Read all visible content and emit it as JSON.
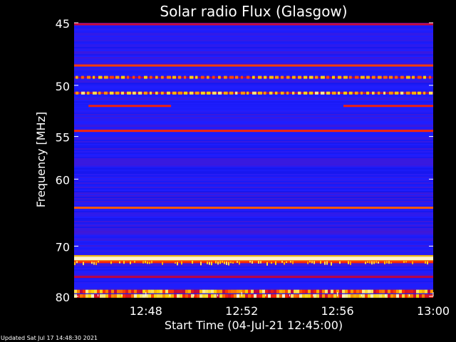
{
  "chart_data": {
    "type": "heatmap",
    "title": "Solar radio Flux (Glasgow)",
    "xlabel": "Start Time (04-Jul-21 12:45:00)",
    "ylabel": "Frequency [MHz]",
    "x_ticks": [
      "12:48",
      "12:52",
      "12:56",
      "13:00"
    ],
    "x_tick_minutes": [
      3,
      7,
      11,
      15
    ],
    "xlim_minutes": [
      0,
      15
    ],
    "y_ticks": [
      45,
      50,
      55,
      60,
      70,
      80
    ],
    "ylim": [
      45,
      80
    ],
    "y_scale": "reciprocal",
    "colormap": [
      "#0000b4",
      "#1e1eff",
      "#b4004a",
      "#ff2a00",
      "#ffd200",
      "#ffffff"
    ],
    "background_level": 0.2,
    "bands": [
      {
        "freq_mhz": 45.1,
        "level": 0.45,
        "pattern": "solid"
      },
      {
        "freq_mhz": 48.3,
        "level": 0.62,
        "pattern": "solid"
      },
      {
        "freq_mhz": 49.3,
        "level": 0.72,
        "pattern": "dotted"
      },
      {
        "freq_mhz": 50.7,
        "level": 0.82,
        "pattern": "dotted"
      },
      {
        "freq_mhz": 51.9,
        "level": 0.55,
        "pattern": "segments"
      },
      {
        "freq_mhz": 54.4,
        "level": 0.58,
        "pattern": "solid"
      },
      {
        "freq_mhz": 63.9,
        "level": 0.66,
        "pattern": "solid"
      },
      {
        "freq_mhz": 72.2,
        "level": 0.96,
        "pattern": "solid"
      },
      {
        "freq_mhz": 72.9,
        "level": 0.74,
        "pattern": "speckled"
      },
      {
        "freq_mhz": 75.8,
        "level": 0.42,
        "pattern": "solid"
      },
      {
        "freq_mhz": 78.9,
        "level": 0.78,
        "pattern": "patchy"
      },
      {
        "freq_mhz": 79.9,
        "level": 0.82,
        "pattern": "patchy"
      }
    ],
    "grid": false,
    "legend": "none"
  },
  "footer": {
    "updated": "Updated Sat Jul 17 14:48:30 2021"
  }
}
